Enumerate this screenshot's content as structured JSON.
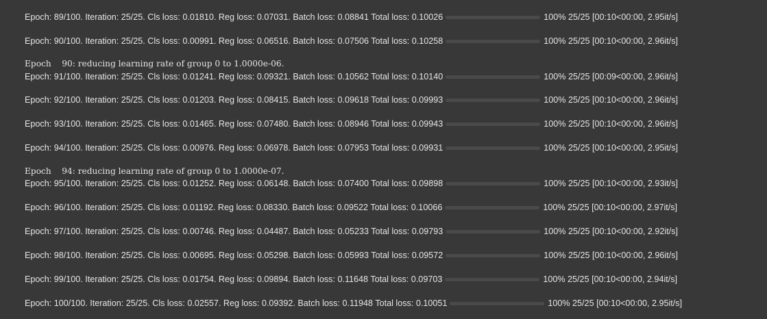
{
  "progress_rows": [
    {
      "desc": "Epoch: 89/100. Iteration: 25/25. Cls loss: 0.01810. Reg loss: 0.07031. Batch loss: 0.08841 Total loss: 0.10026",
      "progress": 1.0,
      "post": "100% 25/25 [00:10<00:00, 2.95it/s]"
    },
    {
      "desc": "Epoch: 90/100. Iteration: 25/25. Cls loss: 0.00991. Reg loss: 0.06516. Batch loss: 0.07506 Total loss: 0.10258",
      "progress": 1.0,
      "post": "100% 25/25 [00:10<00:00, 2.96it/s]"
    },
    {
      "desc": "Epoch: 91/100. Iteration: 25/25. Cls loss: 0.01241. Reg loss: 0.09321. Batch loss: 0.10562 Total loss: 0.10140",
      "progress": 1.0,
      "post": "100% 25/25 [00:09<00:00, 2.96it/s]"
    },
    {
      "desc": "Epoch: 92/100. Iteration: 25/25. Cls loss: 0.01203. Reg loss: 0.08415. Batch loss: 0.09618 Total loss: 0.09993",
      "progress": 1.0,
      "post": "100% 25/25 [00:10<00:00, 2.96it/s]"
    },
    {
      "desc": "Epoch: 93/100. Iteration: 25/25. Cls loss: 0.01465. Reg loss: 0.07480. Batch loss: 0.08946 Total loss: 0.09943",
      "progress": 1.0,
      "post": "100% 25/25 [00:10<00:00, 2.96it/s]"
    },
    {
      "desc": "Epoch: 94/100. Iteration: 25/25. Cls loss: 0.00976. Reg loss: 0.06978. Batch loss: 0.07953 Total loss: 0.09931",
      "progress": 1.0,
      "post": "100% 25/25 [00:10<00:00, 2.95it/s]"
    },
    {
      "desc": "Epoch: 95/100. Iteration: 25/25. Cls loss: 0.01252. Reg loss: 0.06148. Batch loss: 0.07400 Total loss: 0.09898",
      "progress": 1.0,
      "post": "100% 25/25 [00:10<00:00, 2.93it/s]"
    },
    {
      "desc": "Epoch: 96/100. Iteration: 25/25. Cls loss: 0.01192. Reg loss: 0.08330. Batch loss: 0.09522 Total loss: 0.10066",
      "progress": 1.0,
      "post": "100% 25/25 [00:10<00:00, 2.97it/s]"
    },
    {
      "desc": "Epoch: 97/100. Iteration: 25/25. Cls loss: 0.00746. Reg loss: 0.04487. Batch loss: 0.05233 Total loss: 0.09793",
      "progress": 1.0,
      "post": "100% 25/25 [00:10<00:00, 2.92it/s]"
    },
    {
      "desc": "Epoch: 98/100. Iteration: 25/25. Cls loss: 0.00695. Reg loss: 0.05298. Batch loss: 0.05993 Total loss: 0.09572",
      "progress": 1.0,
      "post": "100% 25/25 [00:10<00:00, 2.96it/s]"
    },
    {
      "desc": "Epoch: 99/100. Iteration: 25/25. Cls loss: 0.01754. Reg loss: 0.09894. Batch loss: 0.11648 Total loss: 0.09703",
      "progress": 1.0,
      "post": "100% 25/25 [00:10<00:00, 2.94it/s]"
    },
    {
      "desc": "Epoch: 100/100. Iteration: 25/25. Cls loss: 0.02557. Reg loss: 0.09392. Batch loss: 0.11948 Total loss: 0.10051",
      "progress": 1.0,
      "post": "100% 25/25 [00:10<00:00, 2.95it/s]"
    }
  ],
  "lr_messages": [
    "Epoch    90: reducing learning rate of group 0 to 1.0000e-06.",
    "Epoch    94: reducing learning rate of group 0 to 1.0000e-07."
  ],
  "colors": {
    "background": "#383838",
    "text": "#e6e6e6",
    "bar_fill": "#4a7ee0",
    "bar_track": "#4a4a4a"
  }
}
